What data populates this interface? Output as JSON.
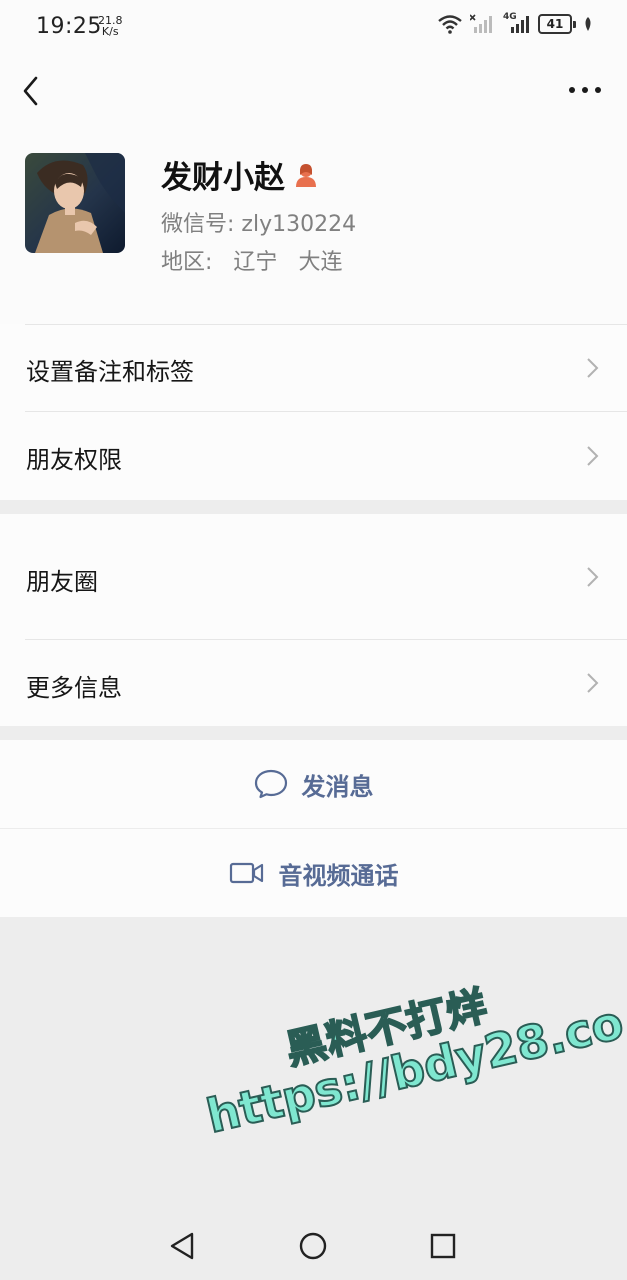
{
  "status_bar": {
    "time": "19:25",
    "net_speed_value": "21.8",
    "net_speed_unit": "K/s",
    "network_label": "4G",
    "battery": "41"
  },
  "header": {
    "back_icon": "chevron-left-icon",
    "more_icon": "more-dots-icon"
  },
  "profile": {
    "nickname": "发财小赵",
    "wechat_id_label": "微信号:",
    "wechat_id": "zly130224",
    "region_label": "地区:",
    "region_province": "辽宁",
    "region_city": "大连",
    "gender_icon": "female-person-icon",
    "accent_color": "#e8704e"
  },
  "menu": {
    "remark_tags": "设置备注和标签",
    "friend_permissions": "朋友权限",
    "moments": "朋友圈",
    "more_info": "更多信息"
  },
  "actions": {
    "send_message": "发消息",
    "video_call": "音视频通话",
    "link_color": "#576b95"
  },
  "watermark": {
    "line1": "黑料不打烊",
    "line2": "https://bdy28.co"
  },
  "nav_bar": {
    "back": "triangle-back-icon",
    "home": "circle-home-icon",
    "recents": "square-recents-icon"
  }
}
